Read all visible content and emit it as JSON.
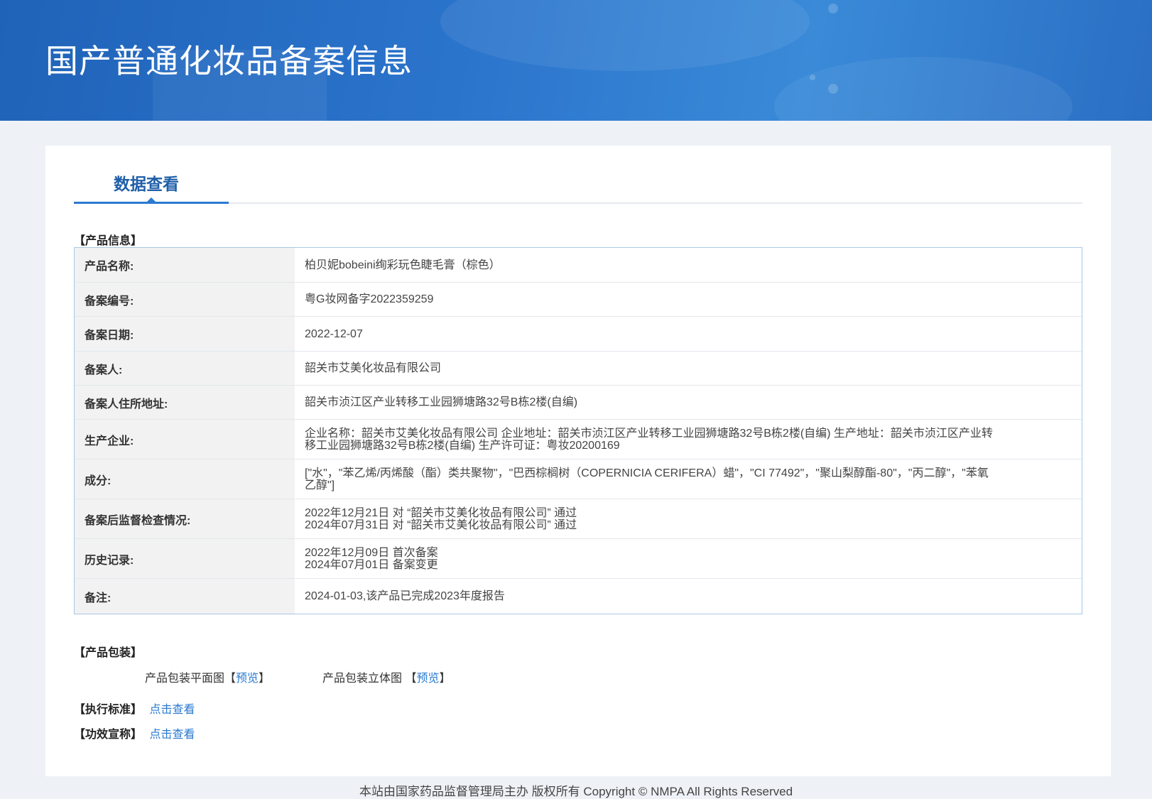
{
  "header": {
    "title": "国产普通化妆品备案信息"
  },
  "tabs": [
    {
      "label": "数据查看",
      "active": true
    }
  ],
  "product_info": {
    "section_title": "【产品信息】",
    "rows": [
      {
        "label": "产品名称:",
        "lines": [
          "柏贝妮bobeini绚彩玩色睫毛膏（棕色）"
        ]
      },
      {
        "label": "备案编号:",
        "lines": [
          "粤G妆网备字2022359259"
        ]
      },
      {
        "label": "备案日期:",
        "lines": [
          "2022-12-07"
        ]
      },
      {
        "label": "备案人:",
        "lines": [
          "韶关市艾美化妆品有限公司"
        ]
      },
      {
        "label": "备案人住所地址:",
        "lines": [
          "韶关市浈江区产业转移工业园狮塘路32号B栋2楼(自编)"
        ]
      },
      {
        "label": "生产企业:",
        "lines": [
          "企业名称：韶关市艾美化妆品有限公司 企业地址：韶关市浈江区产业转移工业园狮塘路32号B栋2楼(自编) 生产地址：韶关市浈江区产业转",
          "移工业园狮塘路32号B栋2楼(自编) 生产许可证：粤妆20200169"
        ]
      },
      {
        "label": "成分:",
        "lines": [
          "[\"水\"，\"苯乙烯/丙烯酸（酯）类共聚物\"，\"巴西棕榈树（COPERNICIA CERIFERA）蜡\"，\"CI 77492\"，\"聚山梨醇酯-80\"，\"丙二醇\"，\"苯氧",
          "乙醇\"]"
        ]
      },
      {
        "label": "备案后监督检查情况:",
        "lines": [
          "2022年12月21日 对 “韶关市艾美化妆品有限公司” 通过",
          "2024年07月31日 对 “韶关市艾美化妆品有限公司” 通过"
        ]
      },
      {
        "label": "历史记录:",
        "lines": [
          "2022年12月09日 首次备案",
          "2024年07月01日 备案变更"
        ]
      },
      {
        "label": "备注:",
        "lines": [
          "2024-01-03,该产品已完成2023年度报告"
        ]
      }
    ]
  },
  "packaging": {
    "section_title": "【产品包装】",
    "flat_label": "产品包装平面图",
    "flat_link": "【预览】",
    "three_d_label": "产品包装立体图",
    "three_d_link": "【预览】"
  },
  "standard": {
    "section_title": "【执行标准】",
    "link": "点击查看"
  },
  "efficacy": {
    "section_title": "【功效宣称】",
    "link": "点击查看"
  },
  "footer": {
    "text": "本站由国家药品监督管理局主办 版权所有 Copyright © NMPA All Rights Reserved"
  },
  "colors": {
    "banner": "#2b74cc",
    "accent": "#2a7ad0",
    "tab_text": "#1f5fa8",
    "table_border": "#a9c8e6",
    "label_bg": "#f2f2f2"
  }
}
